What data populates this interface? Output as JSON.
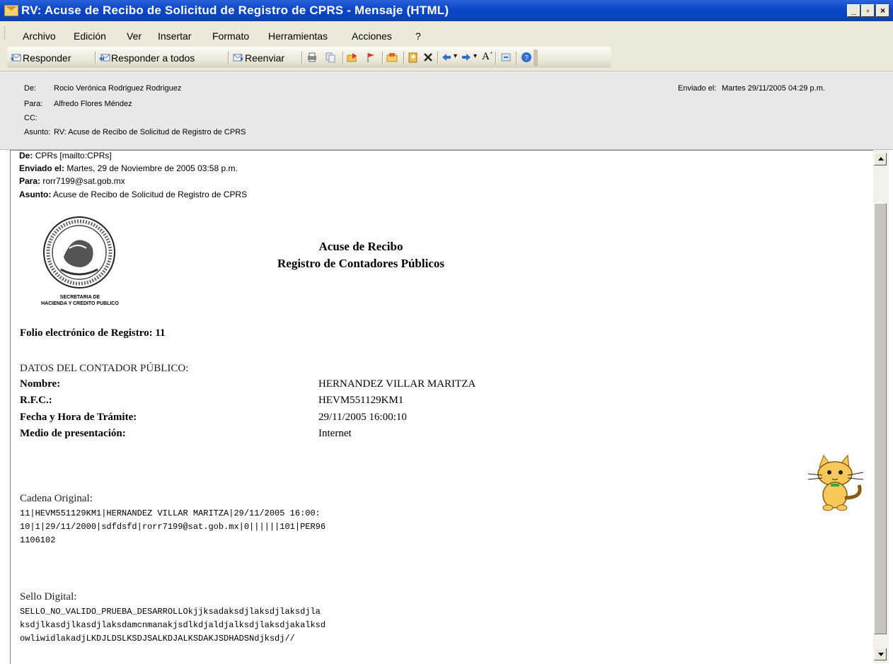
{
  "window": {
    "title": "RV: Acuse de Recibo de Solicitud de Registro de CPRS - Mensaje (HTML)",
    "controls": {
      "minimize": "_",
      "restore": "▫",
      "close": "×"
    }
  },
  "menu": [
    "Archivo",
    "Edición",
    "Ver",
    "Insertar",
    "Formato",
    "Herramientas",
    "Acciones",
    "?"
  ],
  "toolbar": {
    "reply": "Responder",
    "reply_all": "Responder a todos",
    "forward": "Reenviar",
    "font_glyph": "A´"
  },
  "header": {
    "from_label": "De:",
    "from": "Rocio Verónica Rodriguez Rodriguez",
    "to_label": "Para:",
    "to": "Alfredo Flores Méndez",
    "cc_label": "CC:",
    "cc": "",
    "subject_label": "Asunto:",
    "subject": "RV: Acuse de Recibo de Solicitud de Registro de CPRS",
    "sent_label": "Enviado el:",
    "sent": "Martes 29/11/2005 04:29 p.m."
  },
  "forwarded": {
    "from_label": "De:",
    "from": "CPRs [mailto:CPRs]",
    "sent_label": "Enviado el:",
    "sent": "Martes, 29 de Noviembre de 2005 03:58 p.m.",
    "to_label": "Para:",
    "to": "rorr7199@sat.gob.mx",
    "subject_label": "Asunto:",
    "subject": "Acuse de Recibo de Solicitud de Registro de CPRS"
  },
  "receipt": {
    "logo_caption_1": "SECRETARIA DE",
    "logo_caption_2": "HACIENDA Y CREDITO PUBLICO",
    "title_1": "Acuse de Recibo",
    "title_2": "Registro de Contadores Públicos",
    "folio": "Folio electrónico de Registro: 11",
    "section": "DATOS DEL CONTADOR PÚBLICO:",
    "fields": [
      {
        "label": "Nombre:",
        "value": "HERNANDEZ VILLAR MARITZA"
      },
      {
        "label": "R.F.C.:",
        "value": "HEVM551129KM1"
      },
      {
        "label": "Fecha y Hora de Trámite:",
        "value": "29/11/2005 16:00:10"
      },
      {
        "label": "Medio de presentación:",
        "value": "Internet"
      }
    ],
    "cadena_label": "Cadena Original:",
    "cadena_lines": [
      "11|HEVM551129KM1|HERNANDEZ VILLAR MARITZA|29/11/2005 16:00:",
      "10|1|29/11/2000|sdfdsfd|rorr7199@sat.gob.mx|0||||||101|PER96",
      "1106102"
    ],
    "sello_label": "Sello Digital:",
    "sello_lines": [
      "SELLO_NO_VALIDO_PRUEBA_DESARROLLOkjjksadaksdjlaksdjlaksdjla",
      "ksdjlkasdjlkasdjlaksdamcnmanakjsdlkdjaldjalksdjlaksdjakalksd",
      "owliwidlakadjLKDJLDSLKSDJSALKDJALKSDAKJSDHADSNdjksdj//"
    ]
  },
  "colors": {
    "titlebar": "#0a46c8",
    "chrome": "#ece9d8",
    "header_bg": "#e8e8e8"
  }
}
